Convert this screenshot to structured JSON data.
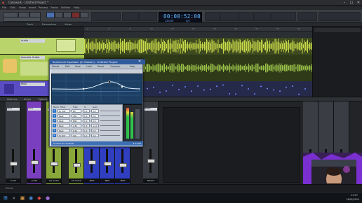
{
  "window": {
    "title": "Cakewalk - Untitled Project *",
    "minimize_glyph": "–",
    "maximize_glyph": "□",
    "close_glyph": "✕"
  },
  "menu": [
    "File",
    "Edit",
    "Views",
    "Insert",
    "Process",
    "Tracks",
    "Utilities",
    "Help"
  ],
  "transport": {
    "time": "00:00:52:00",
    "tempo": "120.00",
    "meter": "4/4"
  },
  "browser_header": {
    "left_label": "Track",
    "mid_label": "Parameters",
    "right_label": "Views"
  },
  "tracks": [
    {
      "name": "Audio",
      "color": "#b9d46a",
      "height_class": "a"
    },
    {
      "name": "Acoustic Guitar",
      "color": "#a7c84f",
      "height_class": "b"
    },
    {
      "name": "MIDI",
      "color": "#6a5ad0",
      "height_class": "c"
    }
  ],
  "ruler_marks": [
    "1",
    "5",
    "9",
    "13",
    "17",
    "21",
    "25",
    "29",
    "33",
    "37",
    "41"
  ],
  "plugin": {
    "title": "Sonitus:fx Equalizer (4: Master) - Untitled Project",
    "close_glyph": "✕",
    "preset_buttons": [
      "Preset",
      "Edit",
      "Save",
      "Load",
      "Reset",
      "Compare",
      "Help"
    ],
    "table_headers": [
      "Band",
      "Filter",
      "Freq",
      "Q",
      "Gain"
    ],
    "bands": [
      {
        "n": "1",
        "filter": "Lo Shlf",
        "freq": "80",
        "q": "1.0",
        "gain": "0.0"
      },
      {
        "n": "2",
        "filter": "Peak",
        "freq": "250",
        "q": "1.0",
        "gain": "0.0"
      },
      {
        "n": "3",
        "filter": "Peak",
        "freq": "800",
        "q": "1.0",
        "gain": "0.0"
      },
      {
        "n": "4",
        "filter": "Peak",
        "freq": "2.5k",
        "q": "1.0",
        "gain": "+2.1"
      },
      {
        "n": "5",
        "filter": "Peak",
        "freq": "6.0k",
        "q": "1.0",
        "gain": "0.0"
      },
      {
        "n": "6",
        "filter": "Hi Shlf",
        "freq": "12k",
        "q": "1.0",
        "gain": "0.0"
      }
    ],
    "status": "Sonitus:fx equalizer",
    "version": "4.12.00"
  },
  "console_bar": {
    "labels": [
      "Modules",
      "Strips",
      "Options"
    ]
  },
  "strips": [
    {
      "name": "Audio",
      "color": "#3a3e44",
      "input": "Input"
    },
    {
      "name": "Audio",
      "color": "#3a3e44",
      "input": "Input"
    },
    {
      "name": "Audio",
      "color": "#7a3fbf",
      "input": "Input"
    },
    {
      "name": "Audio",
      "color": "#7a3fbf",
      "input": "Input"
    },
    {
      "name": "AG Guitar",
      "color": "#8aa83a",
      "input": "Input"
    },
    {
      "name": "AG Guitar",
      "color": "#8aa83a",
      "input": "Input"
    },
    {
      "name": "MIDI",
      "color": "#2f3fbf",
      "input": "Input"
    },
    {
      "name": "MIDI",
      "color": "#2f3fbf",
      "input": "Input"
    },
    {
      "name": "MIDI",
      "color": "#2f3fbf",
      "input": "Input"
    },
    {
      "name": "Master",
      "color": "#3a3e44",
      "input": "Master"
    }
  ],
  "status_bar": {
    "left": "Ready",
    "right": "4/4"
  },
  "taskbar": {
    "time": "11:27",
    "date": "26/02/2024"
  },
  "colors": {
    "track_audio": "#b9d46a",
    "track_guitar": "#a7c84f",
    "track_midi": "#6a5ad0",
    "waveform": "#c9db4a",
    "eq_curve": "#e6f2ff",
    "accent": "#2f5a9c"
  }
}
